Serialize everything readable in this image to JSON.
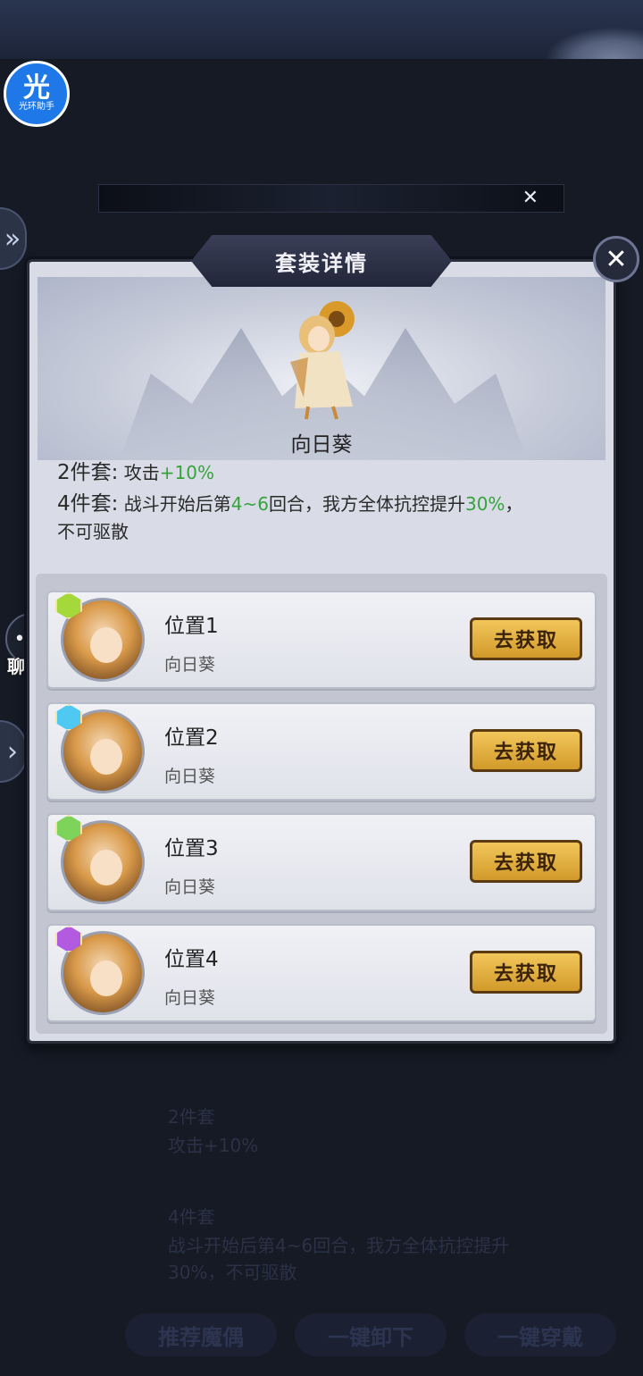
{
  "underlay": {
    "ghost_texts": [
      "2件套",
      "攻击+10%",
      "4件套",
      "战斗开始后第4~6回合，我方全体抗控提升",
      "30%，不可驱散"
    ],
    "buttons": [
      "推荐魔偶",
      "一键卸下",
      "一键穿戴"
    ]
  },
  "helper": {
    "big": "光",
    "small": "光环助手"
  },
  "chat": {
    "label": "聊天"
  },
  "panel": {
    "title": "套装详情",
    "set_name": "向日葵",
    "bonus2": {
      "label": "2件套:",
      "text": "攻击",
      "value": "+10%"
    },
    "bonus4": {
      "label": "4件套:",
      "text_a": "战斗开始后第",
      "range": "4~6",
      "text_b": "回合，我方全体抗控提升",
      "value": "30%",
      "text_c": "，",
      "line2": "不可驱散"
    },
    "slots": [
      {
        "name": "位置1",
        "sub": "向日葵",
        "button": "去获取",
        "gem_color": "#a5d93b"
      },
      {
        "name": "位置2",
        "sub": "向日葵",
        "button": "去获取",
        "gem_color": "#4fc8f2"
      },
      {
        "name": "位置3",
        "sub": "向日葵",
        "button": "去获取",
        "gem_color": "#7ed35a"
      },
      {
        "name": "位置4",
        "sub": "向日葵",
        "button": "去获取",
        "gem_color": "#b25be0"
      }
    ]
  }
}
